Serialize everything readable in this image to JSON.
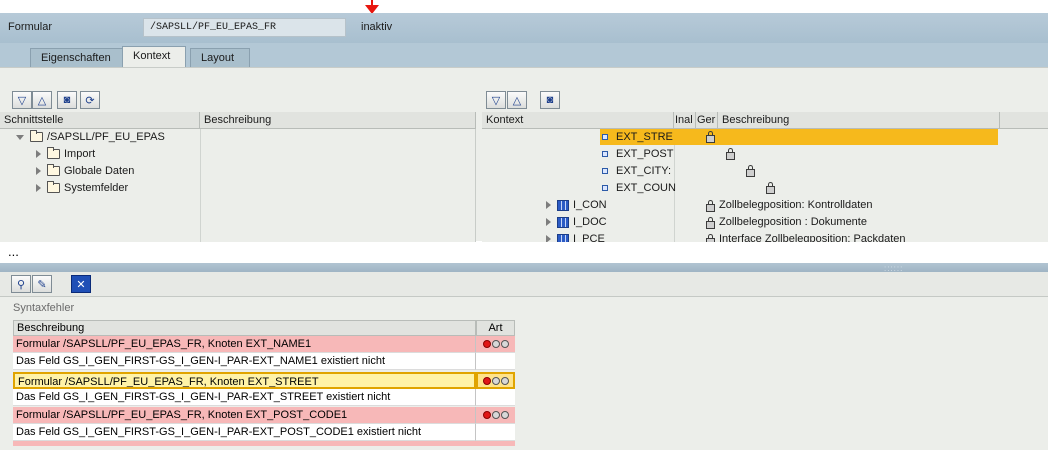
{
  "header": {
    "label": "Formular",
    "form_name": "/SAPSLL/PF_EU_EPAS_FR",
    "status": "inaktiv"
  },
  "tabs": [
    {
      "label": "Eigenschaften"
    },
    {
      "label": "Kontext"
    },
    {
      "label": "Layout"
    }
  ],
  "left_tree": {
    "columns": {
      "interface": "Schnittstelle",
      "description": "Beschreibung"
    },
    "root": "/SAPSLL/PF_EU_EPAS",
    "children": [
      "Import",
      "Globale Daten",
      "Systemfelder"
    ]
  },
  "right_tree": {
    "columns": {
      "context": "Kontext",
      "inal": "Inal",
      "ger": "Ger",
      "description": "Beschreibung"
    },
    "nodes": [
      {
        "label": "EXT_STRE",
        "description": ""
      },
      {
        "label": "EXT_POST",
        "description": ""
      },
      {
        "label": "EXT_CITY:",
        "description": ""
      },
      {
        "label": "EXT_COUN",
        "description": ""
      },
      {
        "label": "I_CON",
        "description": "Zollbelegposition: Kontrolldaten"
      },
      {
        "label": "I_DOC",
        "description": "Zollbelegposition : Dokumente"
      },
      {
        "label": "I_PCE",
        "description": "Interface Zollbelegposition: Packdaten"
      }
    ]
  },
  "ellipsis": "...",
  "errors": {
    "title": "Syntaxfehler",
    "columns": {
      "description": "Beschreibung",
      "type": "Art"
    },
    "rows": [
      {
        "text": "Formular /SAPSLL/PF_EU_EPAS_FR, Knoten EXT_NAME1",
        "lamp": true
      },
      {
        "text": "Das Feld GS_I_GEN_FIRST-GS_I_GEN-I_PAR-EXT_NAME1 existiert nicht",
        "lamp": false
      },
      {
        "text": "Formular /SAPSLL/PF_EU_EPAS_FR, Knoten EXT_STREET",
        "lamp": true
      },
      {
        "text": "Das Feld GS_I_GEN_FIRST-GS_I_GEN-I_PAR-EXT_STREET existiert nicht",
        "lamp": false
      },
      {
        "text": "Formular /SAPSLL/PF_EU_EPAS_FR, Knoten EXT_POST_CODE1",
        "lamp": true
      },
      {
        "text": "Das Feld GS_I_GEN_FIRST-GS_I_GEN-I_PAR-EXT_POST_CODE1 existiert nicht",
        "lamp": false
      }
    ]
  }
}
